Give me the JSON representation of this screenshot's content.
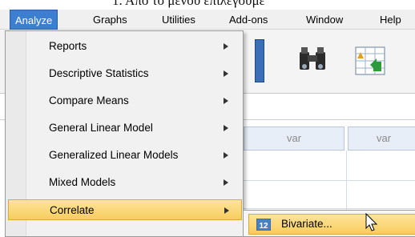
{
  "caption_fragment": "1.   Από το μενού επιλέγουμε",
  "menubar": {
    "items": [
      {
        "label": "Analyze",
        "active": true
      },
      {
        "label": "Graphs"
      },
      {
        "label": "Utilities"
      },
      {
        "label": "Add-ons"
      },
      {
        "label": "Window"
      },
      {
        "label": "Help"
      }
    ]
  },
  "toolbar": {
    "icons": [
      "data-editor-icon",
      "binoculars-find-icon",
      "insert-cases-icon"
    ]
  },
  "grid": {
    "column_headers": [
      "var",
      "var"
    ]
  },
  "analyze_menu": {
    "items": [
      {
        "label": "Reports",
        "has_submenu": true
      },
      {
        "label": "Descriptive Statistics",
        "has_submenu": true
      },
      {
        "label": "Compare Means",
        "has_submenu": true
      },
      {
        "label": "General Linear Model",
        "has_submenu": true
      },
      {
        "label": "Generalized Linear Models",
        "has_submenu": true
      },
      {
        "label": "Mixed Models",
        "has_submenu": true
      },
      {
        "label": "Correlate",
        "has_submenu": true,
        "highlighted": true
      }
    ]
  },
  "correlate_submenu": {
    "items": [
      {
        "label": "Bivariate...",
        "icon": "bivariate-12-icon",
        "icon_text": "12"
      }
    ]
  },
  "colors": {
    "menu_active": "#3c7fd1",
    "highlight": "#f8cd5d",
    "column_header_bg": "#e7eef7"
  }
}
